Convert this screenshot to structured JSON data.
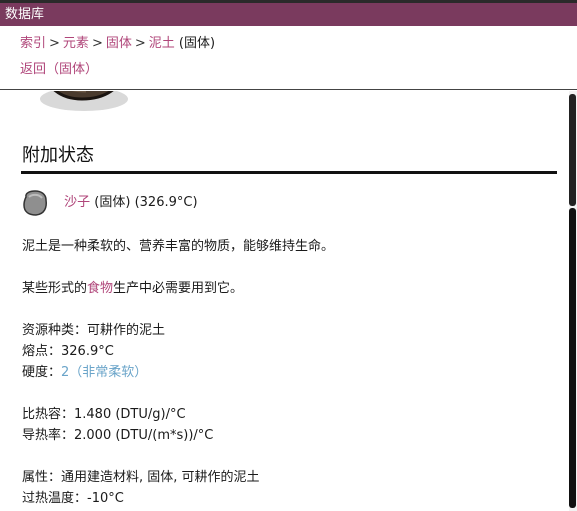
{
  "window": {
    "title": "数据库"
  },
  "breadcrumb": {
    "items": [
      "索引",
      "元素",
      "固体",
      "泥土"
    ],
    "separator": ">",
    "current_suffix": "(固体)"
  },
  "back_link": "返回（固体）",
  "section": {
    "title": "附加状态"
  },
  "state": {
    "name": "沙子",
    "phase": "(固体)",
    "temperature": "(326.9°C)"
  },
  "description": {
    "line1": "泥土是一种柔软的、营养丰富的物质，能够维持生命。",
    "line2_prefix": "某些形式的",
    "line2_link": "食物",
    "line2_suffix": "生产中必需要用到它。"
  },
  "properties": {
    "resource_type": "资源种类：可耕作的泥土",
    "melting_point": "熔点：326.9°C",
    "hardness_label": "硬度：",
    "hardness_value": "2（非常柔软）",
    "specific_heat": "比热容：1.480 (DTU/g)/°C",
    "thermal_conductivity": "导热率：2.000 (DTU/(m*s))/°C",
    "attributes": "属性：通用建造材料, 固体, 可耕作的泥土",
    "overheat_temp": "过热温度：-10°C"
  },
  "colors": {
    "title_bar": "#7a3a5e",
    "link": "#b0467a",
    "number": "#6aa4c9"
  }
}
